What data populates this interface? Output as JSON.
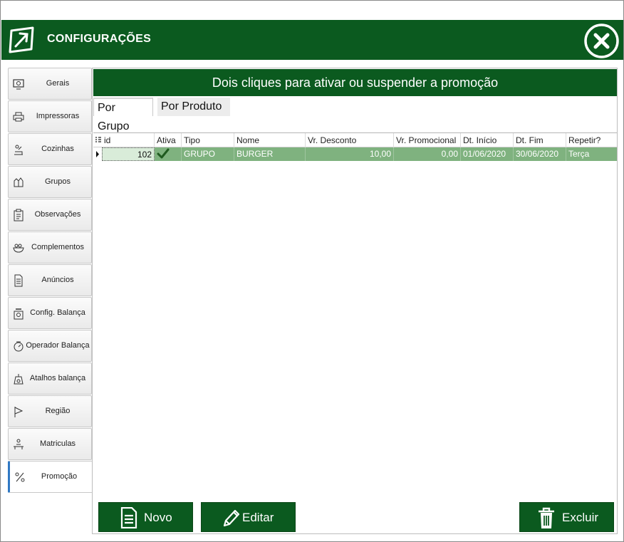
{
  "window": {
    "title": "CONFIGURAÇÕES"
  },
  "sidebar": {
    "items": [
      {
        "label": "Gerais",
        "icon": "monitor-gear-icon"
      },
      {
        "label": "Impressoras",
        "icon": "printer-icon"
      },
      {
        "label": "Cozinhas",
        "icon": "kitchen-icon"
      },
      {
        "label": "Grupos",
        "icon": "groups-icon"
      },
      {
        "label": "Observações",
        "icon": "clipboard-icon"
      },
      {
        "label": "Complementos",
        "icon": "bowl-icon"
      },
      {
        "label": "Anúncios",
        "icon": "document-icon"
      },
      {
        "label": "Config. Balança",
        "icon": "scale-icon"
      },
      {
        "label": "Operador  Balança",
        "icon": "scale-dial-icon"
      },
      {
        "label": "Atalhos balança",
        "icon": "scale-weight-icon"
      },
      {
        "label": "Região",
        "icon": "flag-icon"
      },
      {
        "label": "Matriculas",
        "icon": "matricula-icon"
      },
      {
        "label": "Promoção",
        "icon": "promotion-icon"
      }
    ],
    "active_index": 12
  },
  "main": {
    "banner": "Dois cliques para ativar ou suspender a promoção",
    "tabs": [
      {
        "label": "Por Grupo",
        "active": true
      },
      {
        "label": "Por Produto",
        "active": false
      }
    ],
    "table": {
      "columns": [
        "id",
        "Ativa",
        "Tipo",
        "Nome",
        "Vr. Desconto",
        "Vr. Promocional",
        "Dt. Início",
        "Dt. Fim",
        "Repetir?"
      ],
      "rows": [
        {
          "id": "102",
          "ativa": true,
          "tipo": "GRUPO",
          "nome": "BURGER",
          "vr_desconto": "10,00",
          "vr_promocional": "0,00",
          "dt_inicio": "01/06/2020",
          "dt_fim": "30/06/2020",
          "repetir": "Terça"
        }
      ]
    },
    "buttons": {
      "new": "Novo",
      "edit": "Editar",
      "delete": "Excluir"
    }
  },
  "colors": {
    "brand_green": "#0b5a1f",
    "row_selected": "#7fb27f",
    "active_tab_accent": "#2f78c4"
  }
}
